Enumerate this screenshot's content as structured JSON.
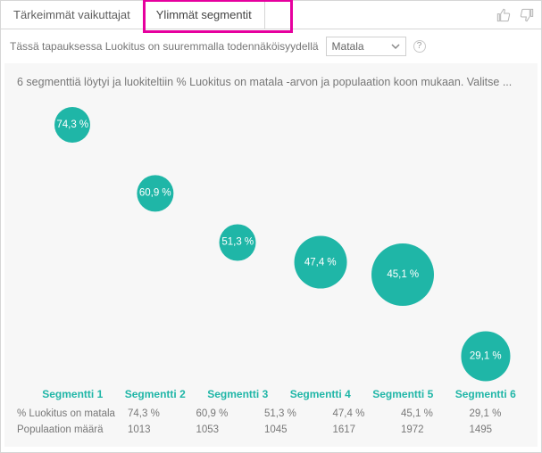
{
  "tabs": {
    "influencers": "Tärkeimmät vaikuttajat",
    "segments": "Ylimmät segmentit"
  },
  "subhead": {
    "prefix": "Tässä tapauksessa Luokitus on suuremmalla todennäköisyydellä",
    "selected": "Matala",
    "help": "?"
  },
  "plot": {
    "description": "6 segmenttiä löytyi ja luokiteltiin % Luokitus on matala -arvon ja populaation koon mukaan. Valitse ..."
  },
  "rows": {
    "pct_label": "% Luokitus on matala",
    "pop_label": "Populaation määrä"
  },
  "chart_data": {
    "type": "scatter",
    "title": "",
    "xlabel": "",
    "ylabel": "",
    "size_meaning": "Populaation määrä",
    "y_meaning": "% Luokitus on matala",
    "ylim": [
      25,
      80
    ],
    "categories": [
      "Segmentti 1",
      "Segmentti 2",
      "Segmentti 3",
      "Segmentti 4",
      "Segmentti 5",
      "Segmentti 6"
    ],
    "series": [
      {
        "name": "% Luokitus on matala",
        "values": [
          74.3,
          60.9,
          51.3,
          47.4,
          45.1,
          29.1
        ],
        "labels": [
          "74,3 %",
          "60,9 %",
          "51,3 %",
          "47,4 %",
          "45,1 %",
          "29,1 %"
        ]
      },
      {
        "name": "Populaation määrä",
        "values": [
          1013,
          1053,
          1045,
          1617,
          1972,
          1495
        ]
      }
    ],
    "table": {
      "pct": [
        "74,3 %",
        "60,9 %",
        "51,3 %",
        "47,4 %",
        "45,1 %",
        "29,1 %"
      ],
      "pop": [
        "1013",
        "1053",
        "1045",
        "1617",
        "1972",
        "1495"
      ]
    }
  }
}
